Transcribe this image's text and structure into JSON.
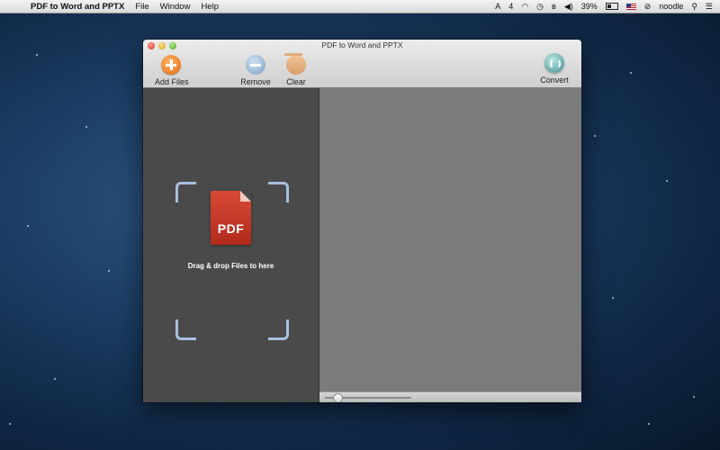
{
  "menubar": {
    "app_name": "PDF to Word and PPTX",
    "menus": [
      "File",
      "Window",
      "Help"
    ],
    "status_count": "4",
    "battery": "39%",
    "user": "noodle"
  },
  "window": {
    "title": "PDF to Word and PPTX",
    "toolbar": {
      "add_label": "Add Files",
      "remove_label": "Remove",
      "clear_label": "Clear",
      "convert_label": "Convert"
    },
    "dropzone": {
      "icon_text": "PDF",
      "hint": "Drag & drop Files to here"
    }
  },
  "colors": {
    "accent_orange": "#e36a0c",
    "pdf_red": "#c2321f",
    "left_pane": "#4a4a4a",
    "right_pane": "#7b7b7b"
  }
}
